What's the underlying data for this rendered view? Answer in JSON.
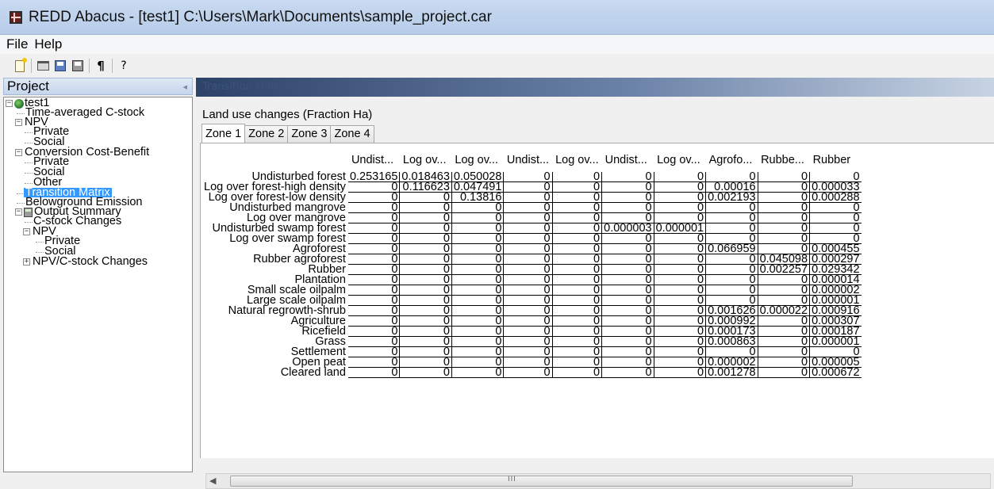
{
  "window": {
    "title": "REDD Abacus - [test1] C:\\Users\\Mark\\Documents\\sample_project.car"
  },
  "menu": [
    "File",
    "Help"
  ],
  "toolbar": {
    "icons": [
      "new-file-icon",
      "open-folder-icon",
      "save-icon",
      "save-as-icon",
      "paragraph-icon",
      "help-icon"
    ],
    "paragraph_glyph": "¶",
    "help_glyph": "?"
  },
  "project": {
    "title": "Project",
    "pin_glyph": "◂",
    "tree": [
      {
        "label": "test1",
        "level": 0,
        "expander": "−",
        "icon": "globe-icon"
      },
      {
        "label": "Time-averaged C-stock",
        "level": 1
      },
      {
        "label": "NPV",
        "level": 1,
        "expander": "−"
      },
      {
        "label": "Private",
        "level": 2
      },
      {
        "label": "Social",
        "level": 2
      },
      {
        "label": "Conversion Cost-Benefit",
        "level": 1,
        "expander": "−"
      },
      {
        "label": "Private",
        "level": 2
      },
      {
        "label": "Social",
        "level": 2
      },
      {
        "label": "Other",
        "level": 2
      },
      {
        "label": "Transition Matrix",
        "level": 1,
        "selected": true
      },
      {
        "label": "Belowground Emission",
        "level": 1
      },
      {
        "label": "Output Summary",
        "level": 1,
        "expander": "−",
        "icon": "calculator-icon"
      },
      {
        "label": "C-stock Changes",
        "level": 2
      },
      {
        "label": "NPV",
        "level": 2,
        "expander": "−"
      },
      {
        "label": "Private",
        "level": 3
      },
      {
        "label": "Social",
        "level": 3
      },
      {
        "label": "NPV/C-stock Changes",
        "level": 2,
        "expander": "+"
      }
    ]
  },
  "main": {
    "header": "Transition Matrix",
    "section_label": "Land use changes (Fraction Ha)",
    "tabs": [
      "Zone 1",
      "Zone 2",
      "Zone 3",
      "Zone 4"
    ],
    "active_tab": 0,
    "columns": [
      "Undist...",
      "Log ov...",
      "Log ov...",
      "Undist...",
      "Log ov...",
      "Undist...",
      "Log ov...",
      "Agrofo...",
      "Rubbe...",
      "Rubber"
    ],
    "rows": [
      {
        "label": "Undisturbed forest",
        "values": [
          "0.253165",
          "0.018463",
          "0.050028",
          "0",
          "0",
          "0",
          "0",
          "0",
          "0",
          "0"
        ]
      },
      {
        "label": "Log over forest-high density",
        "values": [
          "0",
          "0.116623",
          "0.047491",
          "0",
          "0",
          "0",
          "0",
          "0.00016",
          "0",
          "0.000033"
        ]
      },
      {
        "label": "Log over forest-low density",
        "values": [
          "0",
          "0",
          "0.13816",
          "0",
          "0",
          "0",
          "0",
          "0.002193",
          "0",
          "0.000288"
        ]
      },
      {
        "label": "Undisturbed mangrove",
        "values": [
          "0",
          "0",
          "0",
          "0",
          "0",
          "0",
          "0",
          "0",
          "0",
          "0"
        ]
      },
      {
        "label": "Log over mangrove",
        "values": [
          "0",
          "0",
          "0",
          "0",
          "0",
          "0",
          "0",
          "0",
          "0",
          "0"
        ]
      },
      {
        "label": "Undisturbed swamp forest",
        "values": [
          "0",
          "0",
          "0",
          "0",
          "0",
          "0.000003",
          "0.000001",
          "0",
          "0",
          "0"
        ]
      },
      {
        "label": "Log over swamp forest",
        "values": [
          "0",
          "0",
          "0",
          "0",
          "0",
          "0",
          "0",
          "0",
          "0",
          "0"
        ]
      },
      {
        "label": "Agroforest",
        "values": [
          "0",
          "0",
          "0",
          "0",
          "0",
          "0",
          "0",
          "0.066959",
          "0",
          "0.000455"
        ]
      },
      {
        "label": "Rubber agroforest",
        "values": [
          "0",
          "0",
          "0",
          "0",
          "0",
          "0",
          "0",
          "0",
          "0.045098",
          "0.000297"
        ]
      },
      {
        "label": "Rubber",
        "values": [
          "0",
          "0",
          "0",
          "0",
          "0",
          "0",
          "0",
          "0",
          "0.002257",
          "0.029342"
        ]
      },
      {
        "label": "Plantation",
        "values": [
          "0",
          "0",
          "0",
          "0",
          "0",
          "0",
          "0",
          "0",
          "0",
          "0.000014"
        ]
      },
      {
        "label": "Small scale oilpalm",
        "values": [
          "0",
          "0",
          "0",
          "0",
          "0",
          "0",
          "0",
          "0",
          "0",
          "0.000002"
        ]
      },
      {
        "label": "Large scale oilpalm",
        "values": [
          "0",
          "0",
          "0",
          "0",
          "0",
          "0",
          "0",
          "0",
          "0",
          "0.000001"
        ]
      },
      {
        "label": "Natural regrowth-shrub",
        "values": [
          "0",
          "0",
          "0",
          "0",
          "0",
          "0",
          "0",
          "0.001626",
          "0.000022",
          "0.000916"
        ]
      },
      {
        "label": "Agriculture",
        "values": [
          "0",
          "0",
          "0",
          "0",
          "0",
          "0",
          "0",
          "0.000992",
          "0",
          "0.000307"
        ]
      },
      {
        "label": "Ricefield",
        "values": [
          "0",
          "0",
          "0",
          "0",
          "0",
          "0",
          "0",
          "0.000173",
          "0",
          "0.000187"
        ]
      },
      {
        "label": "Grass",
        "values": [
          "0",
          "0",
          "0",
          "0",
          "0",
          "0",
          "0",
          "0.000863",
          "0",
          "0.000001"
        ]
      },
      {
        "label": "Settlement",
        "values": [
          "0",
          "0",
          "0",
          "0",
          "0",
          "0",
          "0",
          "0",
          "0",
          "0"
        ]
      },
      {
        "label": "Open peat",
        "values": [
          "0",
          "0",
          "0",
          "0",
          "0",
          "0",
          "0",
          "0.000002",
          "0",
          "0.000005"
        ]
      },
      {
        "label": "Cleared land",
        "values": [
          "0",
          "0",
          "0",
          "0",
          "0",
          "0",
          "0",
          "0.001278",
          "0",
          "0.000672"
        ]
      }
    ],
    "scrollbar": {
      "left_arrow": "◀",
      "grip": "III"
    }
  }
}
